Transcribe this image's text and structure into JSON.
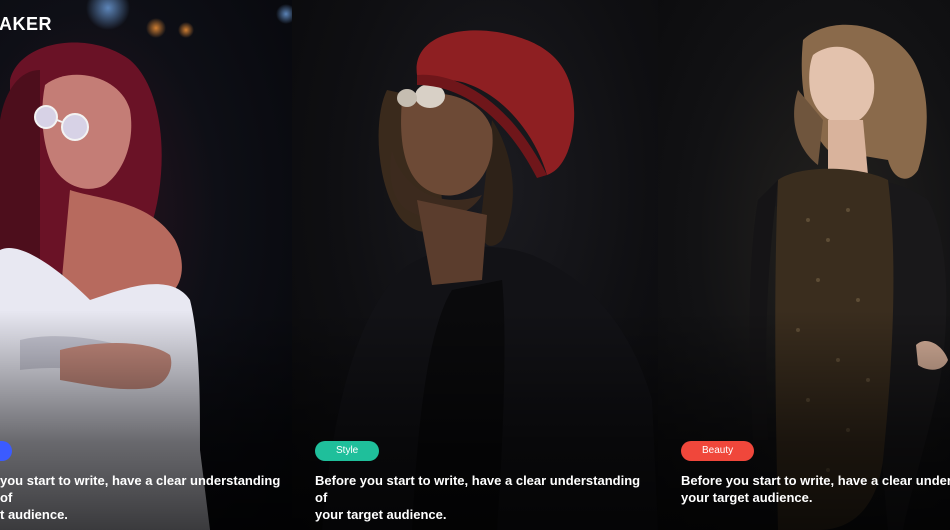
{
  "site": {
    "logo": "AKER"
  },
  "cards": [
    {
      "tag": {
        "label": "",
        "color": "#3b5bff"
      },
      "caption_line1": "you start to write, have a clear understanding of",
      "caption_line2": "t audience."
    },
    {
      "tag": {
        "label": "Style",
        "color": "#1fbf9b"
      },
      "caption_line1": "Before you start to write, have a clear understanding of",
      "caption_line2": "your target audience."
    },
    {
      "tag": {
        "label": "Beauty",
        "color": "#f0473b"
      },
      "caption_line1": "Before you start to write, have a clear understan",
      "caption_line2": "your target audience."
    }
  ]
}
